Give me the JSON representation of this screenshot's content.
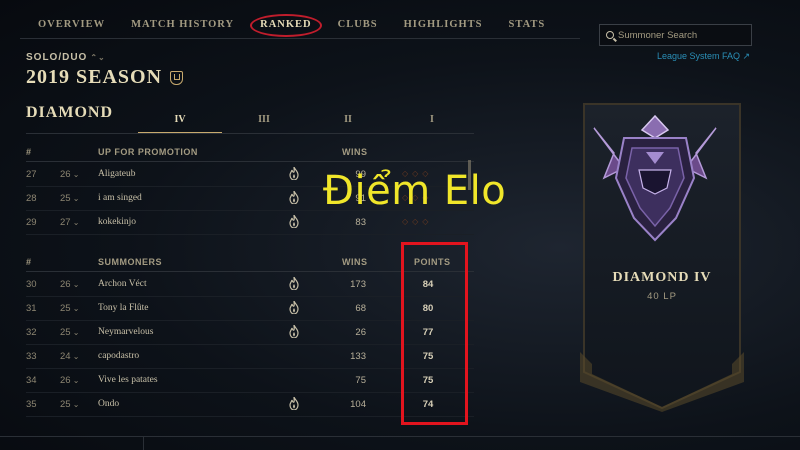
{
  "nav": {
    "tabs": [
      {
        "label": "OVERVIEW"
      },
      {
        "label": "MATCH HISTORY"
      },
      {
        "label": "RANKED"
      },
      {
        "label": "CLUBS"
      },
      {
        "label": "HIGHLIGHTS"
      },
      {
        "label": "STATS"
      }
    ],
    "active_tab": "RANKED"
  },
  "queue": {
    "label": "SOLO/DUO"
  },
  "season": {
    "label": "2019 SEASON"
  },
  "tier": {
    "name": "DIAMOND",
    "divisions": [
      "IV",
      "III",
      "II",
      "I"
    ],
    "active_division": "IV"
  },
  "promo_table": {
    "headers": {
      "rank": "#",
      "name": "UP FOR PROMOTION",
      "wins": "WINS"
    },
    "rows": [
      {
        "rank": "27",
        "prev": "26",
        "name": "Aligateub",
        "hot": true,
        "wins": "99"
      },
      {
        "rank": "28",
        "prev": "25",
        "name": "i am singed",
        "hot": true,
        "wins": "91"
      },
      {
        "rank": "29",
        "prev": "27",
        "name": "kokekinjo",
        "hot": true,
        "wins": "83"
      }
    ]
  },
  "summoners_table": {
    "headers": {
      "rank": "#",
      "name": "SUMMONERS",
      "wins": "WINS",
      "points": "POINTS"
    },
    "rows": [
      {
        "rank": "30",
        "prev": "26",
        "name": "Archon Véct",
        "hot": true,
        "wins": "173",
        "points": "84"
      },
      {
        "rank": "31",
        "prev": "25",
        "name": "Tony la Flûte",
        "hot": true,
        "wins": "68",
        "points": "80"
      },
      {
        "rank": "32",
        "prev": "25",
        "name": "Neymarvelous",
        "hot": true,
        "wins": "26",
        "points": "77"
      },
      {
        "rank": "33",
        "prev": "24",
        "name": "capodastro",
        "hot": false,
        "wins": "133",
        "points": "75"
      },
      {
        "rank": "34",
        "prev": "26",
        "name": "Vive les patates",
        "hot": false,
        "wins": "75",
        "points": "75"
      },
      {
        "rank": "35",
        "prev": "25",
        "name": "Ondo",
        "hot": true,
        "wins": "104",
        "points": "74"
      }
    ]
  },
  "annotation": {
    "text": "Điểm Elo",
    "color": "#f0e62a",
    "box_color": "#e2141e"
  },
  "search": {
    "placeholder": "Summoner Search"
  },
  "faq": {
    "label": "League System FAQ ↗"
  },
  "banner": {
    "title": "DIAMOND IV",
    "lp": "40 LP"
  },
  "colors": {
    "gold": "#c8aa6e",
    "link": "#2a8fb7",
    "highlight": "#e2141e"
  }
}
